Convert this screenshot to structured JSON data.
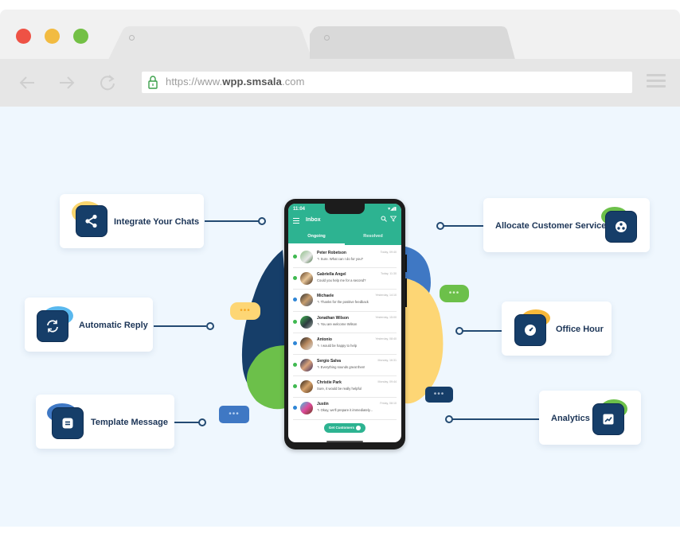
{
  "browser": {
    "traffic_lights": {
      "close": "#ee5245",
      "minimize": "#f2bb41",
      "maximize": "#73c045"
    },
    "tabs": [
      {
        "label": ""
      },
      {
        "label": ""
      }
    ],
    "nav": {
      "back_icon": "arrow-left-icon",
      "forward_icon": "arrow-right-icon",
      "reload_icon": "reload-icon",
      "menu_icon": "hamburger-menu-icon"
    },
    "url": {
      "prefix": "https://www.",
      "domain": "wpp.smsala",
      "suffix": ".com",
      "lock_icon": "lock-icon"
    }
  },
  "features": [
    {
      "label": "Integrate Your Chats",
      "icon": "share-icon",
      "accent": "#f9d56e"
    },
    {
      "label": "Automatic Reply",
      "icon": "sync-icon",
      "accent": "#59b8ee"
    },
    {
      "label": "Template Message",
      "icon": "document-icon",
      "accent": "#3f78c4"
    },
    {
      "label": "Allocate Customer Service",
      "icon": "group-icon",
      "accent": "#6cc04a"
    },
    {
      "label": "Office Hour",
      "icon": "clock-icon",
      "accent": "#f6b83a"
    },
    {
      "label": "Analytics",
      "icon": "chart-icon",
      "accent": "#6cc04a"
    }
  ],
  "bubbles": {
    "dots": "•••"
  },
  "phone": {
    "status_time": "11:04",
    "status_icons": "▾◢▮",
    "title": "Inbox",
    "tabs": [
      "Ongoing",
      "Resolved"
    ],
    "active_tab": "Ongoing",
    "chats": [
      {
        "name": "Peter Robetson",
        "message": "↰ Sure. What can I do for you?",
        "time": "Today, 09:40",
        "status": "#3fb950"
      },
      {
        "name": "Gabriella Angel",
        "message": "Could you help me for a second?",
        "time": "Today, 11:30",
        "status": "#3fb950"
      },
      {
        "name": "Michaele",
        "message": "↰ Thanks for the positive feedback",
        "time": "Yesterday, 14:10",
        "status": "#2f86d6"
      },
      {
        "name": "Jonathan Wilson",
        "message": "↰ You are welcome Wilson",
        "time": "Yesterday, 15:00",
        "status": "#3fb950"
      },
      {
        "name": "Antonio",
        "message": "↰ I would be happy to help",
        "time": "Yesterday, 08:40",
        "status": "#2f86d6"
      },
      {
        "name": "Sergio Salva",
        "message": "↰ Everything sounds great then!",
        "time": "Monday, 16:31",
        "status": "#3fb950"
      },
      {
        "name": "Christie Park",
        "message": "Sure, it would be really helpful",
        "time": "Monday, 09:44",
        "status": "#3fb950"
      },
      {
        "name": "Justin",
        "message": "↰ Okay, we'll prepare it immediately...",
        "time": "Friday, 08:10",
        "status": "#2f86d6"
      }
    ],
    "button_label": "Get Customers"
  }
}
